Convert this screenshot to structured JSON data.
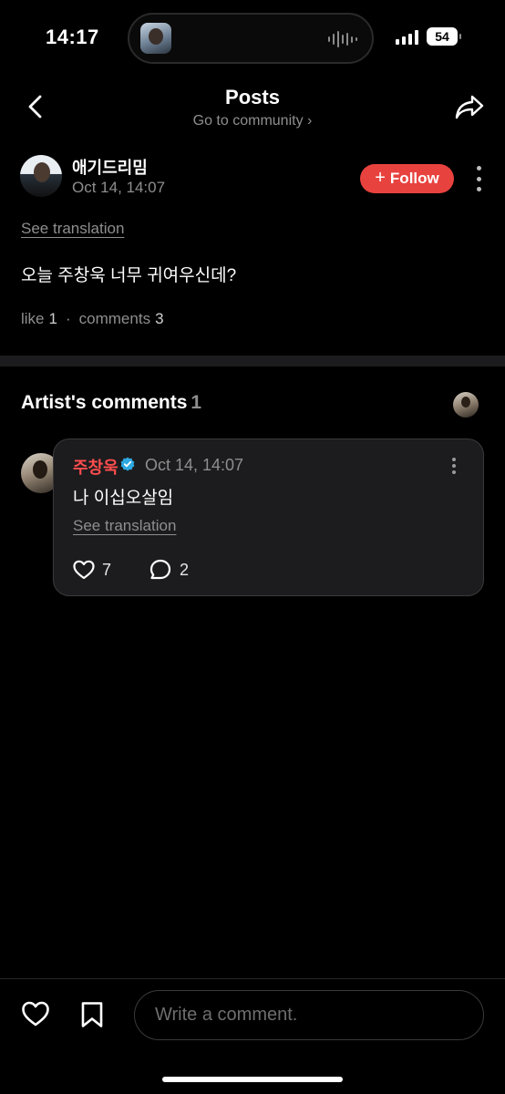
{
  "status": {
    "time": "14:17",
    "battery": "54"
  },
  "nav": {
    "title": "Posts",
    "subtitle": "Go to community ›"
  },
  "post": {
    "author_name": "애기드리밈",
    "timestamp": "Oct 14, 14:07",
    "follow_label": "Follow",
    "see_translation": "See translation",
    "body": "오늘 주창욱 너무 귀여우신데?",
    "like_label": "like",
    "like_count": "1",
    "comments_label": "comments",
    "comments_count": "3"
  },
  "artist_comments": {
    "heading": "Artist's comments",
    "count": "1",
    "items": [
      {
        "name": "주창욱",
        "verified": true,
        "timestamp": "Oct 14, 14:07",
        "text": "나 이십오살임",
        "see_translation": "See translation",
        "likes": "7",
        "replies": "2"
      }
    ]
  },
  "bottom": {
    "comment_placeholder": "Write a comment."
  },
  "colors": {
    "accent_red": "#e8423f",
    "artist_name": "#ff4d4d",
    "verified_blue": "#2fa9e3",
    "muted_text": "#8e8e8e",
    "background": "#000000"
  },
  "icons": [
    "back-chevron-icon",
    "share-arrow-icon",
    "plus-icon",
    "more-vertical-icon",
    "verified-badge-icon",
    "heart-icon",
    "comment-bubble-icon",
    "bookmark-icon"
  ]
}
